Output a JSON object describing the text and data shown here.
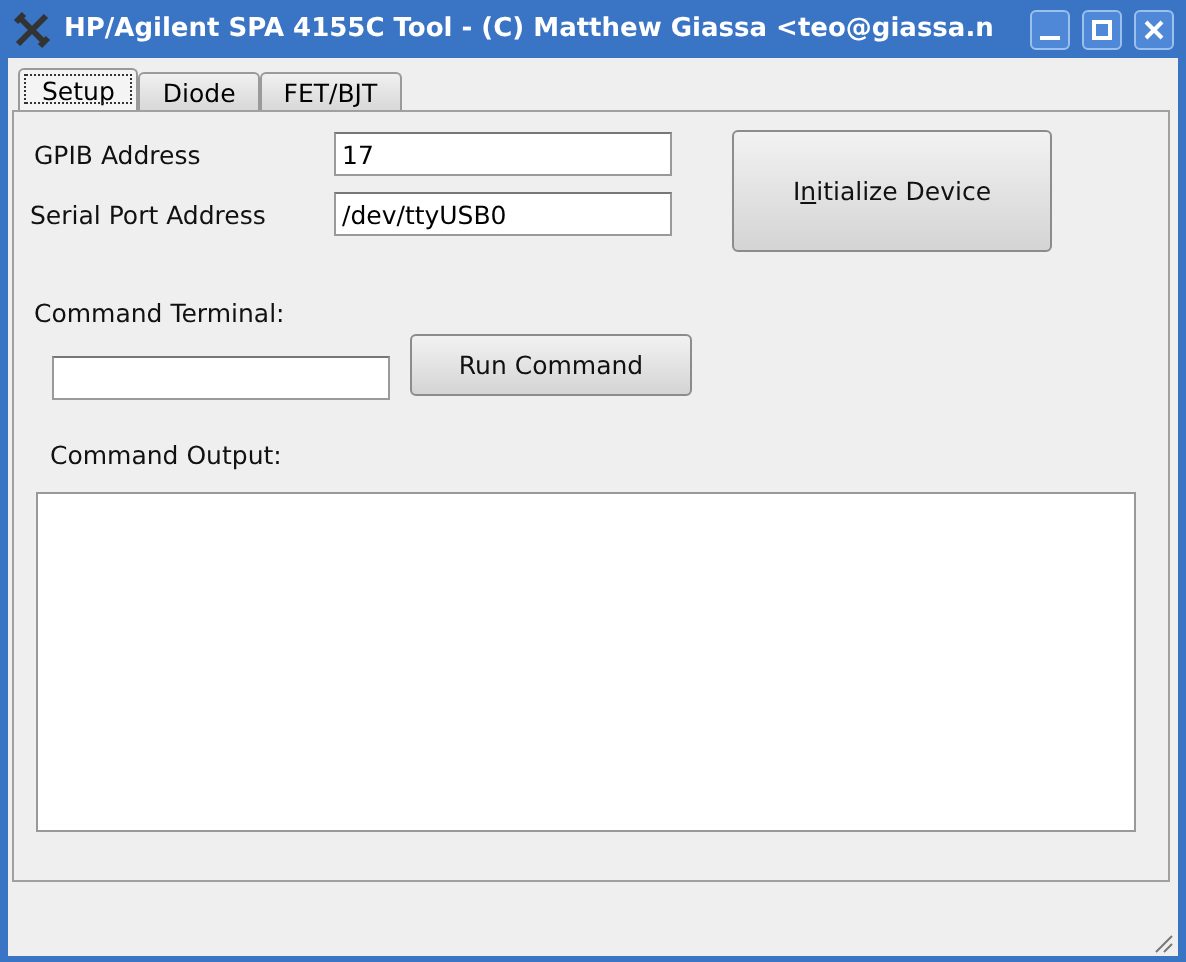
{
  "window": {
    "title": "HP/Agilent SPA 4155C Tool - (C) Matthew Giassa <teo@giassa.n"
  },
  "tabs": [
    {
      "label": "Setup",
      "selected": true
    },
    {
      "label": "Diode",
      "selected": false
    },
    {
      "label": "FET/BJT",
      "selected": false
    }
  ],
  "setup": {
    "gpib_label": "GPIB Address",
    "gpib_value": "17",
    "serial_label": "Serial Port Address",
    "serial_value": "/dev/ttyUSB0",
    "initialize_button": {
      "label_start": "I",
      "mnemonic": "n",
      "label_end": "itialize Device"
    },
    "terminal_label": "Command Terminal:",
    "run_button": "Run Command",
    "output_label": "Command Output:"
  }
}
